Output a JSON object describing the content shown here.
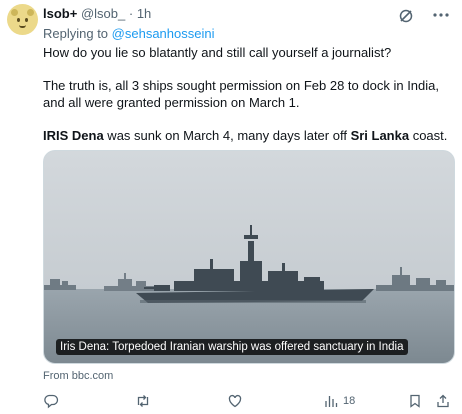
{
  "author": {
    "name": "lsob+",
    "handle": "@lsob_",
    "separator": "·",
    "time": "1h"
  },
  "reply": {
    "prefix": "Replying to ",
    "mention": "@sehsanhosseini"
  },
  "tweet": {
    "line1": "How do you lie so blatantly and still call yourself a journalist?",
    "line2": "The truth is, all 3 ships sought permission on Feb 28 to dock in India, and all were granted permission on March 1.",
    "line3_bold1": "IRIS Dena",
    "line3_mid": " was sunk on March 4, many days later off ",
    "line3_bold2": "Sri Lanka",
    "line3_end": " coast."
  },
  "card": {
    "caption": "Iris Dena: Torpedoed Iranian warship was offered sanctuary in India",
    "source": "From bbc.com"
  },
  "actions": {
    "reply_icon": "reply-icon",
    "retweet_icon": "retweet-icon",
    "like_icon": "heart-icon",
    "views_icon": "views-icon",
    "views_count": "18",
    "bookmark_icon": "bookmark-icon",
    "share_icon": "share-icon"
  },
  "colors": {
    "link": "#1d9bf0",
    "secondary_text": "#536471",
    "primary_text": "#0f1419"
  }
}
